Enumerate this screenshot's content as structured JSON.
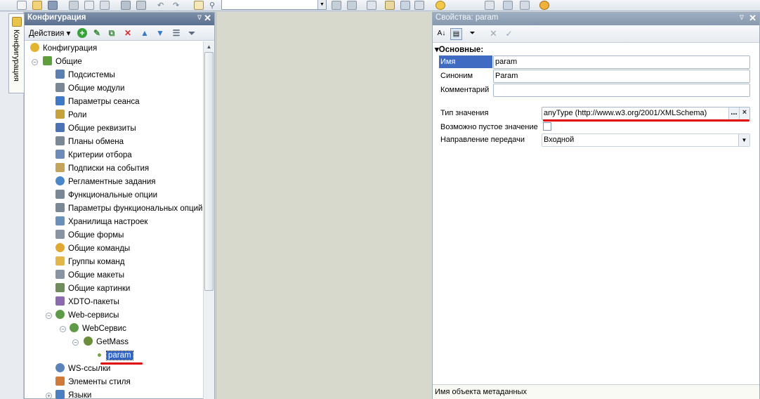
{
  "toolbar": {
    "search_value": ""
  },
  "vertical_tab": {
    "label": "Конфигурация"
  },
  "config_panel": {
    "title": "Конфигурация",
    "actions_label": "Действия",
    "tree": [
      {
        "label": "Конфигурация",
        "icon": "config-icon",
        "color": "#e3b52e"
      },
      {
        "label": "Общие",
        "icon": "common-icon",
        "color": "#5e9e3c"
      },
      {
        "label": "Подсистемы",
        "icon": "subsystems-icon",
        "color": "#5b7fb0"
      },
      {
        "label": "Общие модули",
        "icon": "modules-icon",
        "color": "#7a8896"
      },
      {
        "label": "Параметры сеанса",
        "icon": "session-params-icon",
        "color": "#3d79c4"
      },
      {
        "label": "Роли",
        "icon": "roles-icon",
        "color": "#c7a13a"
      },
      {
        "label": "Общие реквизиты",
        "icon": "attributes-icon",
        "color": "#4a72b5"
      },
      {
        "label": "Планы обмена",
        "icon": "exchange-plans-icon",
        "color": "#7a8896"
      },
      {
        "label": "Критерии отбора",
        "icon": "filter-criteria-icon",
        "color": "#6d8bb8"
      },
      {
        "label": "Подписки на события",
        "icon": "event-subscriptions-icon",
        "color": "#c4a45a"
      },
      {
        "label": "Регламентные задания",
        "icon": "scheduled-jobs-icon",
        "color": "#4a86c8"
      },
      {
        "label": "Функциональные опции",
        "icon": "functional-options-icon",
        "color": "#7a8896"
      },
      {
        "label": "Параметры функциональных опций",
        "icon": "fo-params-icon",
        "color": "#7a8896"
      },
      {
        "label": "Хранилища настроек",
        "icon": "settings-storage-icon",
        "color": "#6a8fb8"
      },
      {
        "label": "Общие формы",
        "icon": "forms-icon",
        "color": "#8894a2"
      },
      {
        "label": "Общие команды",
        "icon": "commands-icon",
        "color": "#e0a936"
      },
      {
        "label": "Группы команд",
        "icon": "command-groups-icon",
        "color": "#e4b548"
      },
      {
        "label": "Общие макеты",
        "icon": "templates-icon",
        "color": "#8894a2"
      },
      {
        "label": "Общие картинки",
        "icon": "pictures-icon",
        "color": "#6f8c5a"
      },
      {
        "label": "XDTO-пакеты",
        "icon": "xdto-icon",
        "color": "#8c6ab0"
      },
      {
        "label": "Web-сервисы",
        "icon": "web-services-icon",
        "color": "#5f9a48"
      },
      {
        "label": "WebСервис",
        "icon": "web-service-icon",
        "color": "#5f9a48"
      },
      {
        "label": "GetMass",
        "icon": "operation-icon",
        "color": "#6b8e3a"
      },
      {
        "label": "param",
        "icon": "param-icon",
        "color": "#79a43a"
      },
      {
        "label": "WS-ссылки",
        "icon": "ws-links-icon",
        "color": "#5a83b8"
      },
      {
        "label": "Элементы стиля",
        "icon": "style-elements-icon",
        "color": "#d07a3a"
      },
      {
        "label": "Языки",
        "icon": "languages-icon",
        "color": "#4b7fc0"
      }
    ]
  },
  "props_panel": {
    "title": "Свойства: param",
    "section": "Основные:",
    "name_label": "Имя",
    "name_value": "param",
    "synonym_label": "Синоним",
    "synonym_value": "Param",
    "comment_label": "Комментарий",
    "comment_value": "",
    "type_label": "Тип значения",
    "type_value": "anyType (http://www.w3.org/2001/XMLSchema)",
    "type_select_btn": "...",
    "type_clear_btn": "×",
    "nullable_label": "Возможно пустое значение",
    "direction_label": "Направление передачи",
    "direction_value": "Входной",
    "footer": "Имя объекта метаданных"
  },
  "annotation_color": "#e00000",
  "selection_color": "#3164c8"
}
